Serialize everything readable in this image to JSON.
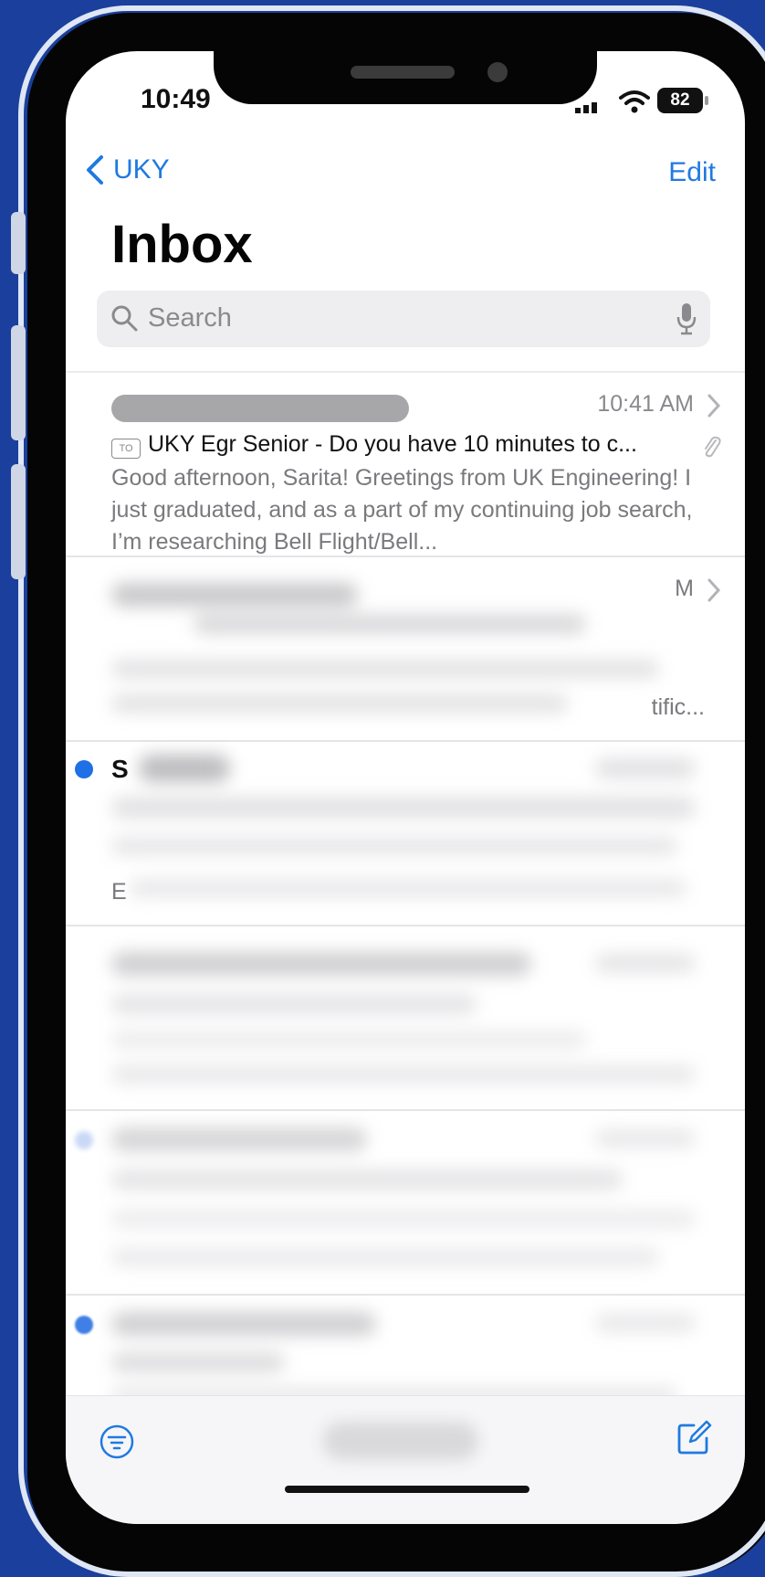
{
  "status_bar": {
    "time": "10:49",
    "battery": "82"
  },
  "nav": {
    "back_label": "UKY",
    "edit_label": "Edit"
  },
  "mailbox": {
    "title": "Inbox"
  },
  "search": {
    "placeholder": "Search"
  },
  "messages": [
    {
      "time": "10:41 AM",
      "to_badge": "TO",
      "subject": "UKY Egr Senior - Do you have 10 minutes to c...",
      "preview": "Good afternoon, Sarita! Greetings from UK Engineering! I just graduated, and as a part of my continuing job search, I’m researching Bell Flight/Bell..."
    },
    {
      "time_partial": "M",
      "preview_partial": "tific..."
    },
    {
      "sender_partial": "S",
      "preview_partial": "E"
    },
    {},
    {},
    {}
  ],
  "colors": {
    "accent": "#1f7ae0",
    "background": "#1a3f9c",
    "decor": "#4bbfbf"
  }
}
